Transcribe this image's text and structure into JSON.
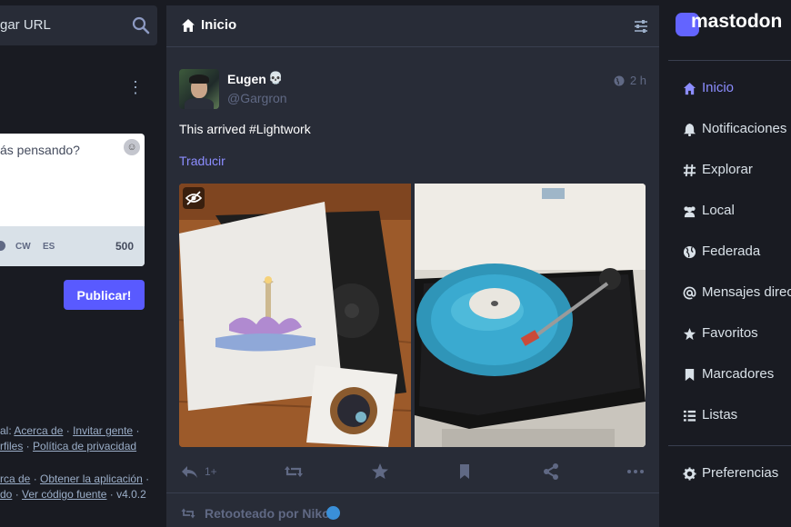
{
  "left": {
    "search": {
      "text": "gar URL"
    },
    "compose": {
      "placeholder": "ás pensando?",
      "cw_label": "CW",
      "lang_label": "ES",
      "char_count": "500",
      "publish_label": "Publicar!"
    },
    "footer": {
      "line1": {
        "prefix": "al: ",
        "about": "Acerca de",
        "sep1": " · ",
        "invite": "Invitar gente",
        "sep2": " ·"
      },
      "line2": {
        "profiles": "rfiles",
        "sep": " · ",
        "privacy": "Política de privacidad"
      },
      "line3": {
        "about": "rca de",
        "sep": " · ",
        "get_app": "Obtener la aplicación",
        "sep2": " ·"
      },
      "line4": {
        "shortcuts": "do",
        "sep": " · ",
        "source": "Ver código fuente",
        "version": " · v4.0.2"
      }
    }
  },
  "center": {
    "header": {
      "title": "Inicio"
    },
    "status": {
      "display_name": "Eugen",
      "badge": "💀",
      "handle": "@Gargron",
      "time": "2 h",
      "content": "This arrived #Lightwork",
      "translate_label": "Traducir",
      "reply_count": "1+"
    },
    "next": {
      "reblogged_by": "Retooteado por Niko"
    }
  },
  "right": {
    "logo_text": "mastodon",
    "nav": [
      {
        "label": "Inicio",
        "icon": "home-icon",
        "active": true
      },
      {
        "label": "Notificaciones",
        "icon": "bell-icon"
      },
      {
        "label": "Explorar",
        "icon": "hashtag-icon"
      },
      {
        "label": "Local",
        "icon": "users-icon"
      },
      {
        "label": "Federada",
        "icon": "globe-icon"
      },
      {
        "label": "Mensajes directos",
        "icon": "at-icon"
      },
      {
        "label": "Favoritos",
        "icon": "star-icon"
      },
      {
        "label": "Marcadores",
        "icon": "bookmark-icon"
      },
      {
        "label": "Listas",
        "icon": "list-icon"
      }
    ],
    "preferences_label": "Preferencias"
  },
  "colors": {
    "accent": "#595aff",
    "link": "#8c8dff",
    "panel": "#282c37",
    "background": "#191b22"
  }
}
